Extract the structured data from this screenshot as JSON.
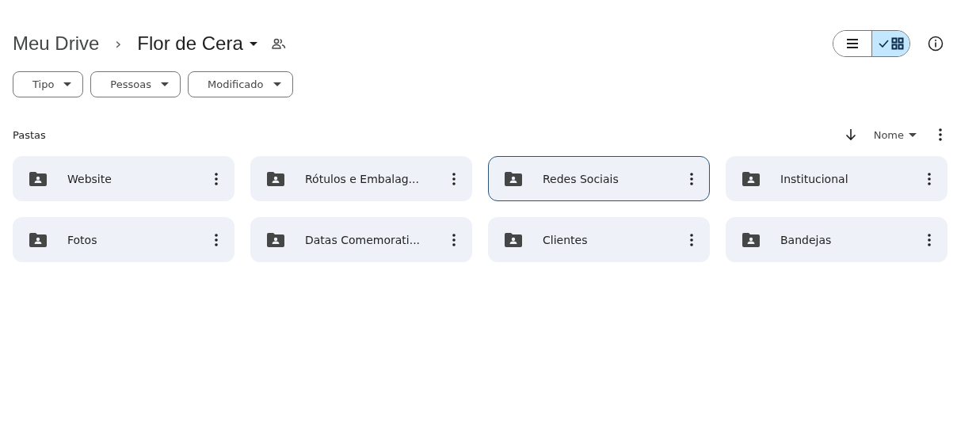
{
  "breadcrumb": {
    "root": "Meu Drive",
    "separator": "›",
    "current": "Flor de Cera"
  },
  "view_toggle": [
    {
      "kind": "list",
      "selected": false
    },
    {
      "kind": "grid",
      "selected": true
    }
  ],
  "filters": [
    {
      "label": "Tipo"
    },
    {
      "label": "Pessoas"
    },
    {
      "label": "Modificado"
    }
  ],
  "section": {
    "title": "Pastas",
    "sort_label": "Nome"
  },
  "folders": [
    {
      "name": "Website",
      "selected": false
    },
    {
      "name": "Rótulos e Embalag...",
      "selected": false
    },
    {
      "name": "Redes Sociais",
      "selected": true
    },
    {
      "name": "Institucional",
      "selected": false
    },
    {
      "name": "Fotos",
      "selected": false
    },
    {
      "name": "Datas Comemorati...",
      "selected": false
    },
    {
      "name": "Clientes",
      "selected": false
    },
    {
      "name": "Bandejas",
      "selected": false
    }
  ]
}
